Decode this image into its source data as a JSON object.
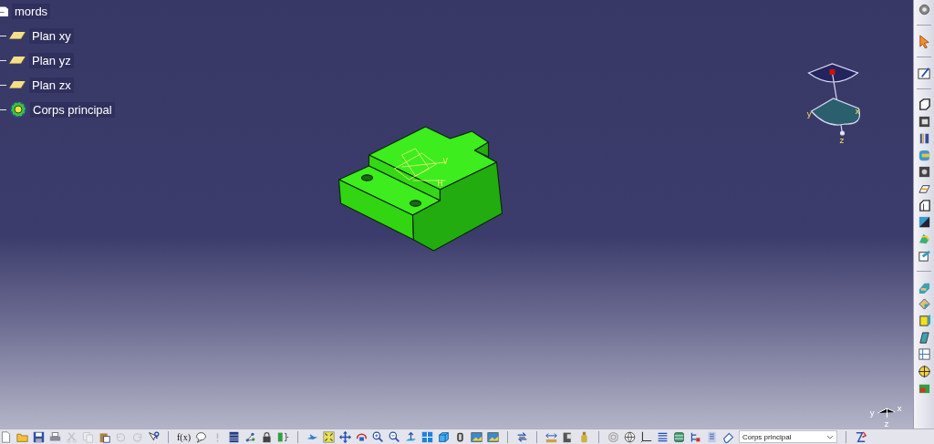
{
  "tree": {
    "root": {
      "label": "mords",
      "children": [
        {
          "label": "Plan xy",
          "kind": "plane"
        },
        {
          "label": "Plan yz",
          "kind": "plane"
        },
        {
          "label": "Plan zx",
          "kind": "plane"
        },
        {
          "label": "Corps principal",
          "kind": "body"
        }
      ]
    }
  },
  "viewport": {
    "sketch_axis_labels": [
      "V",
      "H"
    ],
    "compass_labels": [
      "y",
      "x",
      "z"
    ],
    "triad_labels": [
      "y",
      "x",
      "z"
    ]
  },
  "bottom_toolbar": {
    "standard_buttons": [
      {
        "disabled": false
      },
      {
        "disabled": false
      },
      {
        "disabled": false
      },
      {
        "disabled": false
      },
      {
        "disabled": true
      },
      {
        "disabled": true
      },
      {
        "disabled": false
      },
      {
        "disabled": true
      },
      {
        "disabled": true
      },
      {
        "disabled": false
      }
    ],
    "formula_label": "f(x)",
    "dropdown": {
      "value": "Corps principal"
    }
  }
}
